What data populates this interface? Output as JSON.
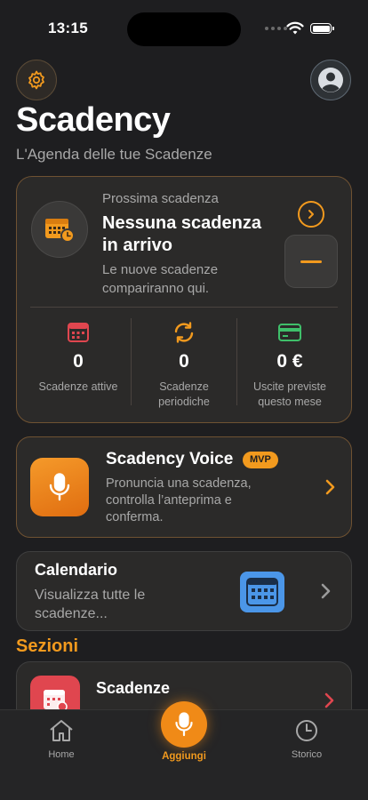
{
  "status_bar": {
    "time": "13:15"
  },
  "header": {
    "title": "Scadency",
    "subtitle": "L'Agenda delle tue Scadenze"
  },
  "next_deadline": {
    "label": "Prossima scadenza",
    "title": "Nessuna scadenza in arrivo",
    "description": "Le nuove scadenze compariranno qui."
  },
  "stats": [
    {
      "value": "0",
      "label": "Scadenze attive",
      "icon": "calendar-icon",
      "color": "#e0464f"
    },
    {
      "value": "0",
      "label": "Scadenze periodiche",
      "icon": "repeat-icon",
      "color": "#f29a1e"
    },
    {
      "value": "0 €",
      "label": "Uscite previste questo mese",
      "icon": "credit-card-icon",
      "color": "#3fbf6a"
    }
  ],
  "voice_card": {
    "title": "Scadency Voice",
    "badge": "MVP",
    "description": "Pronuncia una scadenza, controlla l’anteprima e conferma."
  },
  "calendar_card": {
    "title": "Calendario",
    "description": "Visualizza tutte le scadenze..."
  },
  "sections": {
    "title": "Sezioni",
    "items": [
      {
        "title": "Scadenze",
        "icon": "calendar-icon",
        "color": "#e0464f"
      }
    ]
  },
  "tab_bar": {
    "tabs": [
      {
        "label": "Home",
        "icon": "home-icon"
      },
      {
        "label": "Aggiungi",
        "icon": "microphone-icon"
      },
      {
        "label": "Storico",
        "icon": "clock-icon"
      }
    ]
  },
  "colors": {
    "accent": "#f29a1e",
    "background": "#1e1e20",
    "card": "#2b2a29",
    "blue": "#4b96e8"
  }
}
